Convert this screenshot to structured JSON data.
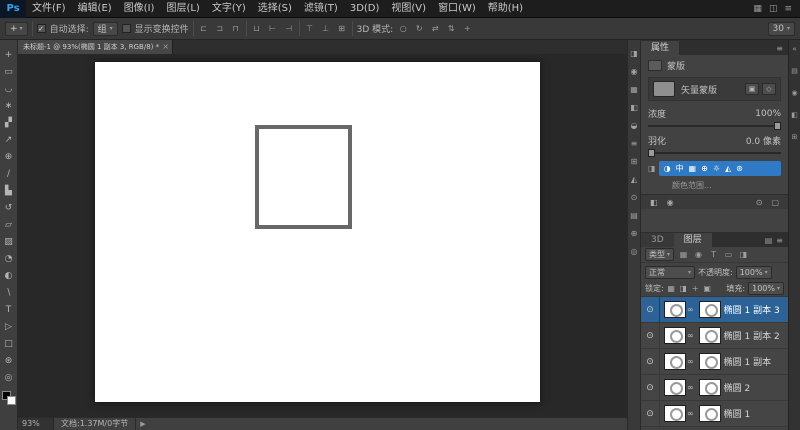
{
  "app": {
    "logo": "Ps"
  },
  "menubar": {
    "items": [
      "文件(F)",
      "编辑(E)",
      "图像(I)",
      "图层(L)",
      "文字(Y)",
      "选择(S)",
      "滤镜(T)",
      "3D(D)",
      "视图(V)",
      "窗口(W)",
      "帮助(H)"
    ],
    "right_icons": [
      "▦",
      "◫",
      "≡"
    ]
  },
  "options": {
    "tool_glyph": "+",
    "tool_arrow": "▾",
    "auto_select_check": "✓",
    "auto_select_label": "自动选择:",
    "auto_select_value": "组",
    "show_transform_label": "显示变换控件",
    "align_icons": [
      "⊏",
      "⊐",
      "⊓",
      "⊔",
      "⊢",
      "⊣",
      "⊤",
      "⊥",
      "⊞"
    ],
    "threed_label": "3D 模式:",
    "threed_icons": [
      "○",
      "↻",
      "⇄",
      "⇅",
      "+"
    ],
    "workspace_value": "30"
  },
  "toolbar": {
    "tools": [
      {
        "name": "move-tool",
        "glyph": "+"
      },
      {
        "name": "marquee-tool",
        "glyph": "▭"
      },
      {
        "name": "lasso-tool",
        "glyph": "◡"
      },
      {
        "name": "quick-select-tool",
        "glyph": "∗"
      },
      {
        "name": "crop-tool",
        "glyph": "▞"
      },
      {
        "name": "eyedropper-tool",
        "glyph": "↗"
      },
      {
        "name": "healing-brush-tool",
        "glyph": "⊕"
      },
      {
        "name": "brush-tool",
        "glyph": "∕"
      },
      {
        "name": "clone-stamp-tool",
        "glyph": "▙"
      },
      {
        "name": "history-brush-tool",
        "glyph": "↺"
      },
      {
        "name": "eraser-tool",
        "glyph": "▱"
      },
      {
        "name": "gradient-tool",
        "glyph": "▨"
      },
      {
        "name": "blur-tool",
        "glyph": "◔"
      },
      {
        "name": "dodge-tool",
        "glyph": "◐"
      },
      {
        "name": "pen-tool",
        "glyph": "∖"
      },
      {
        "name": "type-tool",
        "glyph": "T"
      },
      {
        "name": "path-select-tool",
        "glyph": "▷"
      },
      {
        "name": "shape-tool",
        "glyph": "□"
      },
      {
        "name": "hand-tool",
        "glyph": "⊛"
      },
      {
        "name": "zoom-tool",
        "glyph": "◎"
      }
    ]
  },
  "document": {
    "tab_title": "未标题-1 @ 93%(椭圆 1 副本 3, RGB/8) *",
    "close_glyph": "×",
    "zoom": "93%",
    "doc_info": "文档:1.37M/0字节",
    "status_arrow": "▶"
  },
  "dockstrip": {
    "icons": [
      "◨",
      "◉",
      "▦",
      "◧",
      "◒",
      "≡",
      "⊞",
      "◭",
      "⊙",
      "▤",
      "⊕",
      "◎"
    ]
  },
  "properties": {
    "tab": "属性",
    "menu_icon": "≡",
    "mask_icon": "▣",
    "mask_title": "蒙版",
    "mask_type": "矢量蒙版",
    "mask_buttons": [
      "▣",
      "◇"
    ],
    "density_label": "浓度",
    "density_value": "100%",
    "feather_label": "羽化",
    "feather_value": "0.0 像素",
    "adjust_lead_icon": "◨",
    "adjust_icons": [
      "◑",
      "中",
      "▦",
      "⊕",
      "☼",
      "◭",
      "⊛"
    ],
    "color_range": "颜色范围...",
    "footer_icons": [
      "◧",
      "◉",
      "⊙",
      "▢"
    ]
  },
  "layers": {
    "tab_3d": "3D",
    "tab_layers": "图层",
    "header_icons": [
      "▤",
      "≡"
    ],
    "filter_label": "类型",
    "filter_icons": [
      "▦",
      "◉",
      "T",
      "▭",
      "◨"
    ],
    "blend_mode": "正常",
    "opacity_label": "不透明度:",
    "opacity_value": "100%",
    "lock_label": "锁定:",
    "lock_icons": [
      "▦",
      "◨",
      "+",
      "▣"
    ],
    "fill_label": "填充:",
    "fill_value": "100%",
    "eye_glyph": "⊙",
    "link_glyph": "∞",
    "rows": [
      {
        "name": "椭圆 1 副本 3",
        "selected": true
      },
      {
        "name": "椭圆 1 副本 2",
        "selected": false
      },
      {
        "name": "椭圆 1 副本",
        "selected": false
      },
      {
        "name": "椭圆 2",
        "selected": false
      },
      {
        "name": "椭圆 1",
        "selected": false
      }
    ]
  },
  "rightstrip": {
    "collapse": "«",
    "icons": [
      "▤",
      "◉",
      "◧",
      "⊞"
    ]
  },
  "colors": {
    "selection_blue": "#2c6296",
    "adjust_blue": "#2f7ac4",
    "shape_stroke": "#686868",
    "canvas_white": "#ffffff",
    "logo_blue": "#37a3e8"
  }
}
